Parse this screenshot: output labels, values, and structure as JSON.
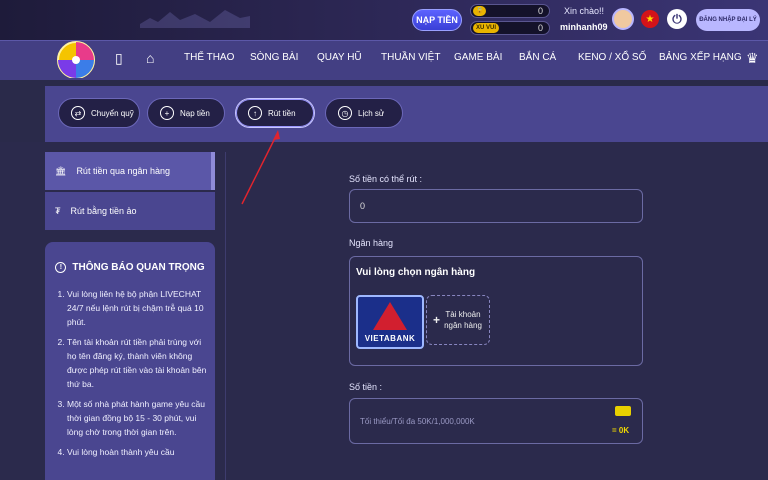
{
  "header": {
    "nap_label": "NẠP TIỀN",
    "wallet1_value": "0",
    "wallet2_value": "0",
    "wallet2_badge": "XU VUI",
    "greeting": "Xin chào!!",
    "username": "minhanh09",
    "agent_label": "ĐĂNG NHẬP ĐẠI LÝ"
  },
  "nav": {
    "items": [
      "THỂ THAO",
      "SÒNG BÀI",
      "QUAY HŨ",
      "THUẦN VIỆT",
      "GAME BÀI",
      "BẮN CÁ",
      "KENO / XỔ SỐ",
      "BẢNG XẾP HẠNG"
    ]
  },
  "tabs": [
    {
      "label": "Chuyển quỹ"
    },
    {
      "label": "Nạp tiền"
    },
    {
      "label": "Rút tiền"
    },
    {
      "label": "Lịch sử"
    }
  ],
  "sidebar": {
    "items": [
      {
        "label": "Rút tiền qua ngân hàng"
      },
      {
        "label": "Rút bằng tiền ảo"
      }
    ]
  },
  "notice": {
    "title": "THÔNG BÁO QUAN TRỌNG",
    "items": [
      "Vui lòng liên hệ bộ phận LIVECHAT 24/7 nếu lệnh rút bị chậm trễ quá 10 phút.",
      "Tên tài khoản rút tiền phải trùng với họ tên đăng ký, thành viên không được phép rút tiền vào tài khoản bên thứ ba.",
      "Một số nhà phát hành game yêu cầu thời gian đồng bộ 15 - 30 phút, vui lòng chờ trong thời gian trên.",
      "Vui lòng hoàn thành yêu cầu"
    ]
  },
  "form": {
    "balance_label": "Số tiền có thể rút :",
    "balance_value": "0",
    "bank_label": "Ngân hàng",
    "bank_select_title": "Vui lòng chọn ngân hàng",
    "bank_name": "VIETABANK",
    "add_account_label": "Tài khoản ngân hàng",
    "amount_label": "Số tiền :",
    "amount_placeholder": "Tối thiểu/Tối đa 50K/1,000,000K",
    "amount_equiv": "= 0K"
  }
}
